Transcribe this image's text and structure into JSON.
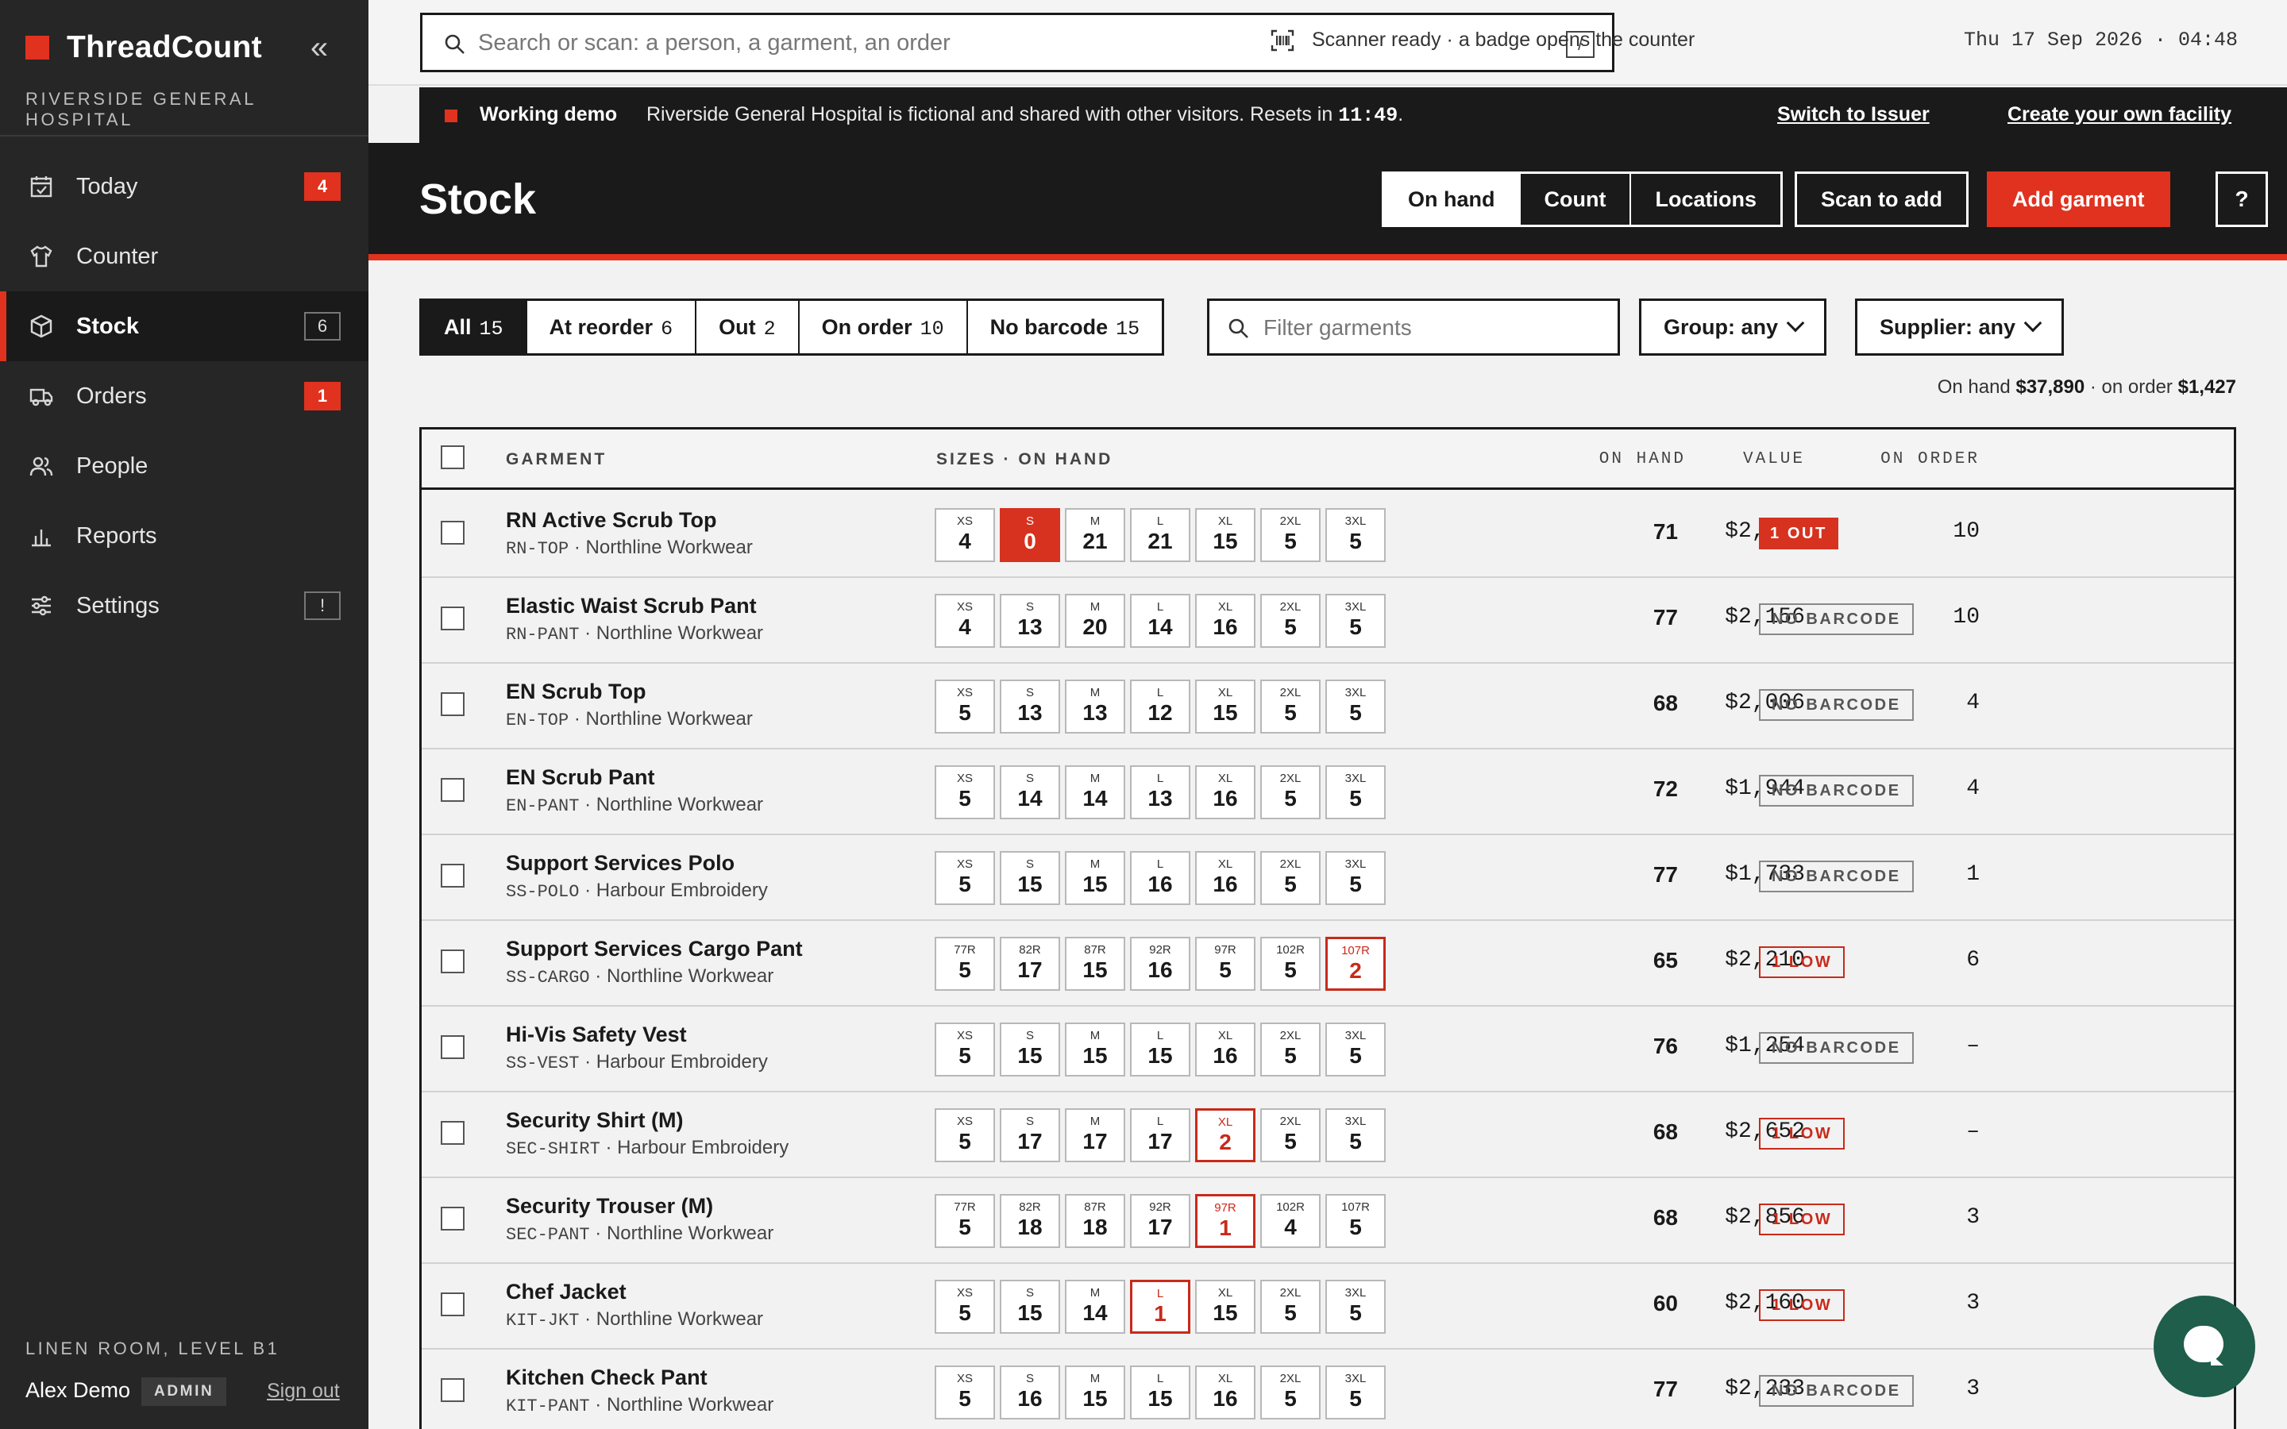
{
  "app": {
    "brand": "ThreadCount",
    "facility": "RIVERSIDE GENERAL HOSPITAL",
    "collapse_icon": "«"
  },
  "nav": [
    {
      "label": "Today",
      "icon": "calendar-check-icon",
      "badge": "4",
      "badge_style": "red"
    },
    {
      "label": "Counter",
      "icon": "shirt-icon",
      "badge": "",
      "badge_style": ""
    },
    {
      "label": "Stock",
      "icon": "box-icon",
      "badge": "6",
      "badge_style": "outline",
      "active": true
    },
    {
      "label": "Orders",
      "icon": "truck-icon",
      "badge": "1",
      "badge_style": "red"
    },
    {
      "label": "People",
      "icon": "people-icon",
      "badge": "",
      "badge_style": ""
    },
    {
      "label": "Reports",
      "icon": "bar-chart-icon",
      "badge": "",
      "badge_style": ""
    },
    {
      "label": "Settings",
      "icon": "sliders-icon",
      "badge": "!",
      "badge_style": "outline"
    }
  ],
  "sidebar_footer": {
    "location": "LINEN ROOM, LEVEL B1",
    "user": "Alex Demo",
    "role": "ADMIN",
    "signout": "Sign out"
  },
  "topbar": {
    "search_placeholder": "Search or scan: a person, a garment, an order",
    "search_shortcut": "/",
    "scanner_status": "Scanner ready · a badge opens the counter",
    "datetime": "Thu 17 Sep 2026 · 04:48"
  },
  "banner": {
    "label": "Working demo",
    "message": "Riverside General Hospital is fictional and shared with other visitors. Resets in ",
    "countdown": "11:49",
    "message_end": ".",
    "link_issuer": "Switch to Issuer",
    "link_create": "Create your own facility"
  },
  "header": {
    "title": "Stock",
    "views": [
      "On hand",
      "Count",
      "Locations"
    ],
    "scan_button": "Scan to add",
    "add_button": "Add garment",
    "help_button": "?"
  },
  "filters": [
    {
      "label": "All",
      "count": "15"
    },
    {
      "label": "At reorder",
      "count": "6"
    },
    {
      "label": "Out",
      "count": "2"
    },
    {
      "label": "On order",
      "count": "10"
    },
    {
      "label": "No barcode",
      "count": "15"
    }
  ],
  "garment_filter_placeholder": "Filter garments",
  "group_dropdown": "Group: any",
  "supplier_dropdown": "Supplier: any",
  "totals": {
    "on_hand_label": "On hand ",
    "on_hand": "$37,890",
    "on_order_label": " · on order ",
    "on_order": "$1,427"
  },
  "columns": {
    "garment": "GARMENT",
    "sizes": "SIZES · ON HAND",
    "on_hand": "ON HAND",
    "value": "VALUE",
    "on_order": "ON ORDER"
  },
  "colors": {
    "accent": "#e0321f",
    "sidebar": "#262626",
    "header": "#1a1a1a",
    "chat": "#1e5e4a"
  },
  "rows": [
    {
      "name": "RN Active Scrub Top",
      "code": "RN-TOP",
      "supplier": "Northline Workwear",
      "sizes": [
        [
          "XS",
          "4",
          ""
        ],
        [
          "S",
          "0",
          "out"
        ],
        [
          "M",
          "21",
          ""
        ],
        [
          "L",
          "21",
          ""
        ],
        [
          "XL",
          "15",
          ""
        ],
        [
          "2XL",
          "5",
          ""
        ],
        [
          "3XL",
          "5",
          ""
        ]
      ],
      "on_hand": "71",
      "value": "$2,237",
      "on_order": "10",
      "status": "1 OUT",
      "status_type": "out"
    },
    {
      "name": "Elastic Waist Scrub Pant",
      "code": "RN-PANT",
      "supplier": "Northline Workwear",
      "sizes": [
        [
          "XS",
          "4",
          ""
        ],
        [
          "S",
          "13",
          ""
        ],
        [
          "M",
          "20",
          ""
        ],
        [
          "L",
          "14",
          ""
        ],
        [
          "XL",
          "16",
          ""
        ],
        [
          "2XL",
          "5",
          ""
        ],
        [
          "3XL",
          "5",
          ""
        ]
      ],
      "on_hand": "77",
      "value": "$2,156",
      "on_order": "10",
      "status": "NO BARCODE",
      "status_type": "nb"
    },
    {
      "name": "EN Scrub Top",
      "code": "EN-TOP",
      "supplier": "Northline Workwear",
      "sizes": [
        [
          "XS",
          "5",
          ""
        ],
        [
          "S",
          "13",
          ""
        ],
        [
          "M",
          "13",
          ""
        ],
        [
          "L",
          "12",
          ""
        ],
        [
          "XL",
          "15",
          ""
        ],
        [
          "2XL",
          "5",
          ""
        ],
        [
          "3XL",
          "5",
          ""
        ]
      ],
      "on_hand": "68",
      "value": "$2,006",
      "on_order": "4",
      "status": "NO BARCODE",
      "status_type": "nb"
    },
    {
      "name": "EN Scrub Pant",
      "code": "EN-PANT",
      "supplier": "Northline Workwear",
      "sizes": [
        [
          "XS",
          "5",
          ""
        ],
        [
          "S",
          "14",
          ""
        ],
        [
          "M",
          "14",
          ""
        ],
        [
          "L",
          "13",
          ""
        ],
        [
          "XL",
          "16",
          ""
        ],
        [
          "2XL",
          "5",
          ""
        ],
        [
          "3XL",
          "5",
          ""
        ]
      ],
      "on_hand": "72",
      "value": "$1,944",
      "on_order": "4",
      "status": "NO BARCODE",
      "status_type": "nb"
    },
    {
      "name": "Support Services Polo",
      "code": "SS-POLO",
      "supplier": "Harbour Embroidery",
      "sizes": [
        [
          "XS",
          "5",
          ""
        ],
        [
          "S",
          "15",
          ""
        ],
        [
          "M",
          "15",
          ""
        ],
        [
          "L",
          "16",
          ""
        ],
        [
          "XL",
          "16",
          ""
        ],
        [
          "2XL",
          "5",
          ""
        ],
        [
          "3XL",
          "5",
          ""
        ]
      ],
      "on_hand": "77",
      "value": "$1,733",
      "on_order": "1",
      "status": "NO BARCODE",
      "status_type": "nb"
    },
    {
      "name": "Support Services Cargo Pant",
      "code": "SS-CARGO",
      "supplier": "Northline Workwear",
      "sizes": [
        [
          "77R",
          "5",
          ""
        ],
        [
          "82R",
          "17",
          ""
        ],
        [
          "87R",
          "15",
          ""
        ],
        [
          "92R",
          "16",
          ""
        ],
        [
          "97R",
          "5",
          ""
        ],
        [
          "102R",
          "5",
          ""
        ],
        [
          "107R",
          "2",
          "low"
        ]
      ],
      "on_hand": "65",
      "value": "$2,210",
      "on_order": "6",
      "status": "1 LOW",
      "status_type": "low"
    },
    {
      "name": "Hi-Vis Safety Vest",
      "code": "SS-VEST",
      "supplier": "Harbour Embroidery",
      "sizes": [
        [
          "XS",
          "5",
          ""
        ],
        [
          "S",
          "15",
          ""
        ],
        [
          "M",
          "15",
          ""
        ],
        [
          "L",
          "15",
          ""
        ],
        [
          "XL",
          "16",
          ""
        ],
        [
          "2XL",
          "5",
          ""
        ],
        [
          "3XL",
          "5",
          ""
        ]
      ],
      "on_hand": "76",
      "value": "$1,254",
      "on_order": "–",
      "status": "NO BARCODE",
      "status_type": "nb"
    },
    {
      "name": "Security Shirt (M)",
      "code": "SEC-SHIRT",
      "supplier": "Harbour Embroidery",
      "sizes": [
        [
          "XS",
          "5",
          ""
        ],
        [
          "S",
          "17",
          ""
        ],
        [
          "M",
          "17",
          ""
        ],
        [
          "L",
          "17",
          ""
        ],
        [
          "XL",
          "2",
          "low"
        ],
        [
          "2XL",
          "5",
          ""
        ],
        [
          "3XL",
          "5",
          ""
        ]
      ],
      "on_hand": "68",
      "value": "$2,652",
      "on_order": "–",
      "status": "1 LOW",
      "status_type": "low"
    },
    {
      "name": "Security Trouser (M)",
      "code": "SEC-PANT",
      "supplier": "Northline Workwear",
      "sizes": [
        [
          "77R",
          "5",
          ""
        ],
        [
          "82R",
          "18",
          ""
        ],
        [
          "87R",
          "18",
          ""
        ],
        [
          "92R",
          "17",
          ""
        ],
        [
          "97R",
          "1",
          "low"
        ],
        [
          "102R",
          "4",
          ""
        ],
        [
          "107R",
          "5",
          ""
        ]
      ],
      "on_hand": "68",
      "value": "$2,856",
      "on_order": "3",
      "status": "1 LOW",
      "status_type": "low"
    },
    {
      "name": "Chef Jacket",
      "code": "KIT-JKT",
      "supplier": "Northline Workwear",
      "sizes": [
        [
          "XS",
          "5",
          ""
        ],
        [
          "S",
          "15",
          ""
        ],
        [
          "M",
          "14",
          ""
        ],
        [
          "L",
          "1",
          "low"
        ],
        [
          "XL",
          "15",
          ""
        ],
        [
          "2XL",
          "5",
          ""
        ],
        [
          "3XL",
          "5",
          ""
        ]
      ],
      "on_hand": "60",
      "value": "$2,160",
      "on_order": "3",
      "status": "1 LOW",
      "status_type": "low"
    },
    {
      "name": "Kitchen Check Pant",
      "code": "KIT-PANT",
      "supplier": "Northline Workwear",
      "sizes": [
        [
          "XS",
          "5",
          ""
        ],
        [
          "S",
          "16",
          ""
        ],
        [
          "M",
          "15",
          ""
        ],
        [
          "L",
          "15",
          ""
        ],
        [
          "XL",
          "16",
          ""
        ],
        [
          "2XL",
          "5",
          ""
        ],
        [
          "3XL",
          "5",
          ""
        ]
      ],
      "on_hand": "77",
      "value": "$2,233",
      "on_order": "3",
      "status": "NO BARCODE",
      "status_type": "nb"
    }
  ]
}
